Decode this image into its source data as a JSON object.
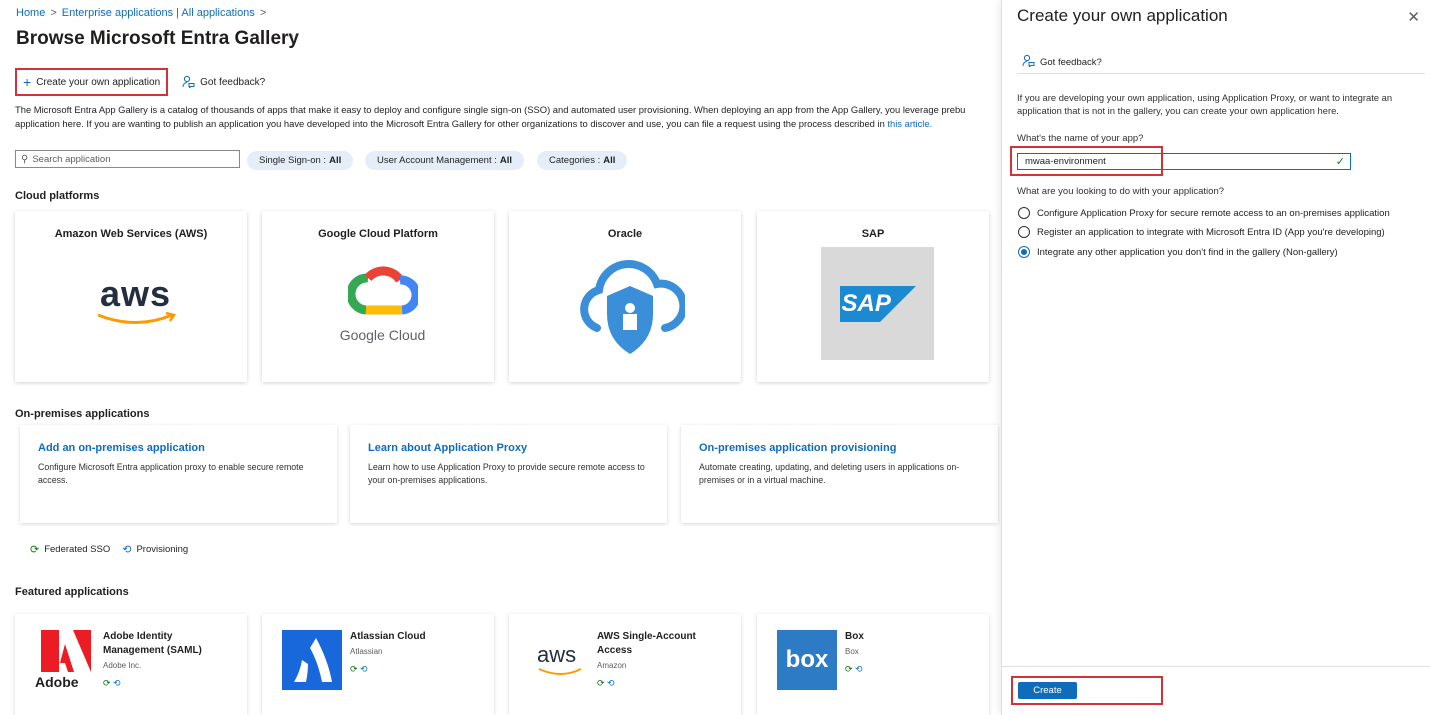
{
  "breadcrumb": {
    "home": "Home",
    "enterprise": "Enterprise applications | All applications"
  },
  "page_title": "Browse Microsoft Entra Gallery",
  "more_label": "···",
  "toolbar": {
    "create_label": "Create your own application",
    "feedback_label": "Got feedback?"
  },
  "intro": {
    "line1": "The Microsoft Entra App Gallery is a catalog of thousands of apps that make it easy to deploy and configure single sign-on (SSO) and automated user provisioning. When deploying an app from the App Gallery, you leverage prebu",
    "line2": "application here. If you are wanting to publish an application you have developed into the Microsoft Entra Gallery for other organizations to discover and use, you can file a request using the process described in",
    "link": "this article."
  },
  "search": {
    "placeholder": "Search application"
  },
  "filters": [
    {
      "label": "Single Sign-on :",
      "value": "All"
    },
    {
      "label": "User Account Management :",
      "value": "All"
    },
    {
      "label": "Categories :",
      "value": "All"
    }
  ],
  "cloud": {
    "heading": "Cloud platforms",
    "items": [
      {
        "title": "Amazon Web Services (AWS)",
        "logo_text": "aws"
      },
      {
        "title": "Google Cloud Platform",
        "logo_text": "Google Cloud"
      },
      {
        "title": "Oracle"
      },
      {
        "title": "SAP",
        "logo_text": "SAP"
      }
    ]
  },
  "onprem": {
    "heading": "On-premises applications",
    "items": [
      {
        "title": "Add an on-premises application",
        "desc": "Configure Microsoft Entra application proxy to enable secure remote access."
      },
      {
        "title": "Learn about Application Proxy",
        "desc": "Learn how to use Application Proxy to provide secure remote access to your on-premises applications."
      },
      {
        "title": "On-premises application provisioning",
        "desc": "Automate creating, updating, and deleting users in applications on-premises or in a virtual machine."
      }
    ]
  },
  "legend": {
    "sso": "Federated SSO",
    "prov": "Provisioning"
  },
  "featured": {
    "heading": "Featured applications",
    "items": [
      {
        "name": "Adobe Identity Management (SAML)",
        "publisher": "Adobe Inc.",
        "logo_text": "Adobe"
      },
      {
        "name": "Atlassian Cloud",
        "publisher": "Atlassian"
      },
      {
        "name": "AWS Single-Account Access",
        "publisher": "Amazon",
        "logo_text": "aws"
      },
      {
        "name": "Box",
        "publisher": "Box",
        "logo_text": "box"
      }
    ]
  },
  "panel": {
    "title": "Create your own application",
    "close": "✕",
    "feedback": "Got feedback?",
    "intro": "If you are developing your own application, using Application Proxy, or want to integrate an application that is not in the gallery, you can create your own application here.",
    "name_label": "What's the name of your app?",
    "name_value": "mwaa-environment",
    "purpose_label": "What are you looking to do with your application?",
    "options": [
      "Configure Application Proxy for secure remote access to an on-premises application",
      "Register an application to integrate with Microsoft Entra ID (App you're developing)",
      "Integrate any other application you don't find in the gallery (Non-gallery)"
    ],
    "selected_option": 3,
    "create_label": "Create"
  },
  "colors": {
    "accent": "#0f6cbd",
    "highlight": "#d13438"
  }
}
